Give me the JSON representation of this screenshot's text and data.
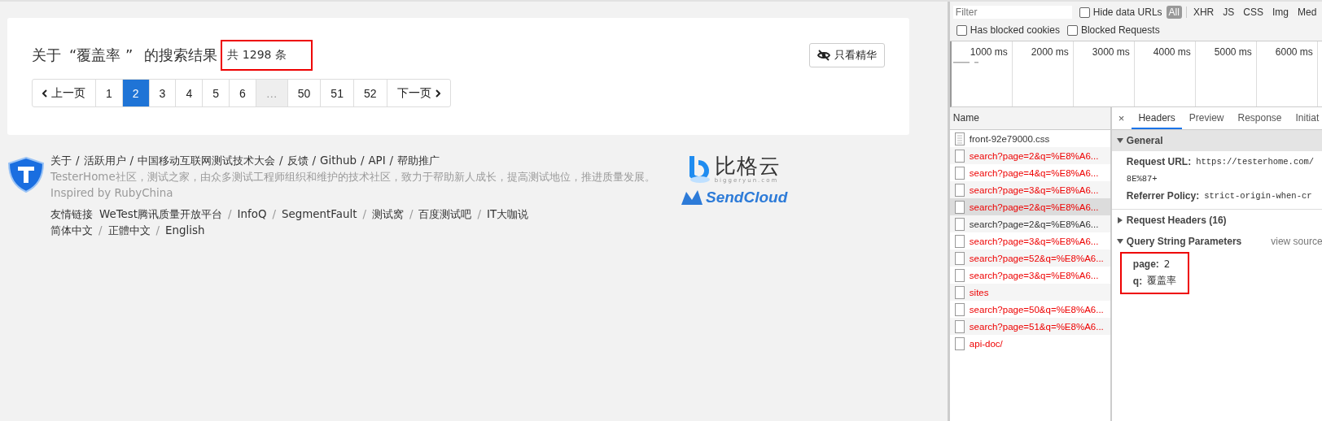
{
  "search_page": {
    "heading": {
      "prefix": "关于",
      "query": "“覆盖率 ”",
      "suffix": "的搜索结果"
    },
    "result_count": {
      "text": "共 1298 条",
      "highlighted": true
    },
    "filter_button": {
      "label": "只看精华"
    },
    "pagination": [
      {
        "kind": "prev",
        "label": "上一页",
        "selected": false
      },
      {
        "kind": "page",
        "label": "1",
        "selected": false
      },
      {
        "kind": "page",
        "label": "2",
        "selected": true
      },
      {
        "kind": "page",
        "label": "3",
        "selected": false
      },
      {
        "kind": "page",
        "label": "4",
        "selected": false
      },
      {
        "kind": "page",
        "label": "5",
        "selected": false
      },
      {
        "kind": "page",
        "label": "6",
        "selected": false
      },
      {
        "kind": "gap",
        "label": "…",
        "selected": false
      },
      {
        "kind": "page",
        "label": "50",
        "selected": false
      },
      {
        "kind": "page",
        "label": "51",
        "selected": false
      },
      {
        "kind": "page",
        "label": "52",
        "selected": false
      },
      {
        "kind": "next",
        "label": "下一页",
        "selected": false
      }
    ]
  },
  "footer": {
    "links": [
      "关于",
      "活跃用户",
      "中国移动互联网测试技术大会",
      "反馈",
      "Github",
      "API",
      "帮助推广"
    ],
    "description": "TesterHome社区，测试之家，由众多测试工程师组织和维护的技术社区，致力于帮助新人成长，提高测试地位，推进质量发展。Inspired by RubyChina",
    "friends_label": "友情链接",
    "friend_links": [
      "WeTest腾讯质量开放平台",
      "InfoQ",
      "SegmentFault",
      "测试窝",
      "百度测试吧",
      "IT大咖说"
    ],
    "languages": [
      "简体中文",
      "正體中文",
      "English"
    ],
    "separator": "/",
    "sponsors": [
      {
        "kind": "bigger",
        "name": "比格云",
        "domain": "biggeryun.com"
      },
      {
        "kind": "sendcloud",
        "name": "SendCloud"
      }
    ]
  },
  "devtools": {
    "filter": {
      "placeholder": "Filter"
    },
    "options": [
      {
        "label": "Hide data URLs",
        "checked": false
      },
      {
        "label": "Has blocked cookies",
        "checked": false
      },
      {
        "label": "Blocked Requests",
        "checked": false
      }
    ],
    "types": [
      {
        "label": "All",
        "selected": true
      },
      {
        "label": "XHR",
        "selected": false
      },
      {
        "label": "JS",
        "selected": false
      },
      {
        "label": "CSS",
        "selected": false
      },
      {
        "label": "Img",
        "selected": false
      },
      {
        "label": "Med",
        "selected": false
      }
    ],
    "timeline_ticks": [
      "1000 ms",
      "2000 ms",
      "3000 ms",
      "4000 ms",
      "5000 ms",
      "6000 ms"
    ],
    "requests_header": "Name",
    "requests": [
      {
        "name": "front-92e79000.css",
        "kind": "stylesheet",
        "error": false,
        "selected": false
      },
      {
        "name": "search?page=2&q=%E8%A6...",
        "kind": "blank",
        "error": true,
        "selected": false
      },
      {
        "name": "search?page=4&q=%E8%A6...",
        "kind": "blank",
        "error": true,
        "selected": false
      },
      {
        "name": "search?page=3&q=%E8%A6...",
        "kind": "blank",
        "error": true,
        "selected": false
      },
      {
        "name": "search?page=2&q=%E8%A6...",
        "kind": "blank",
        "error": true,
        "selected": true
      },
      {
        "name": "search?page=2&q=%E8%A6...",
        "kind": "blank",
        "error": false,
        "selected": false
      },
      {
        "name": "search?page=3&q=%E8%A6...",
        "kind": "blank",
        "error": true,
        "selected": false
      },
      {
        "name": "search?page=52&q=%E8%A6...",
        "kind": "blank",
        "error": true,
        "selected": false
      },
      {
        "name": "search?page=3&q=%E8%A6...",
        "kind": "blank",
        "error": true,
        "selected": false
      },
      {
        "name": "sites",
        "kind": "blank",
        "error": true,
        "selected": false
      },
      {
        "name": "search?page=50&q=%E8%A6...",
        "kind": "blank",
        "error": true,
        "selected": false
      },
      {
        "name": "search?page=51&q=%E8%A6...",
        "kind": "blank",
        "error": true,
        "selected": false
      },
      {
        "name": "api-doc/",
        "kind": "blank",
        "error": true,
        "selected": false
      }
    ],
    "close": "×",
    "tabs": [
      {
        "label": "Headers",
        "selected": true
      },
      {
        "label": "Preview",
        "selected": false
      },
      {
        "label": "Response",
        "selected": false
      },
      {
        "label": "Initiat",
        "selected": false
      }
    ],
    "general": {
      "title": "General",
      "expanded": true,
      "fields": [
        {
          "key": "Request URL:",
          "value": "https://testerhome.com/"
        },
        {
          "value": "8E%87+"
        },
        {
          "key": "Referrer Policy:",
          "value": "strict-origin-when-cr"
        }
      ]
    },
    "request_headers": {
      "title": "Request Headers (16)",
      "expanded": false
    },
    "query_params": {
      "title": "Query String Parameters",
      "expanded": true,
      "action": "view source",
      "highlighted": true,
      "params": [
        {
          "key": "page:",
          "value": "2"
        },
        {
          "key": "q:",
          "value": "覆盖率"
        }
      ]
    }
  }
}
